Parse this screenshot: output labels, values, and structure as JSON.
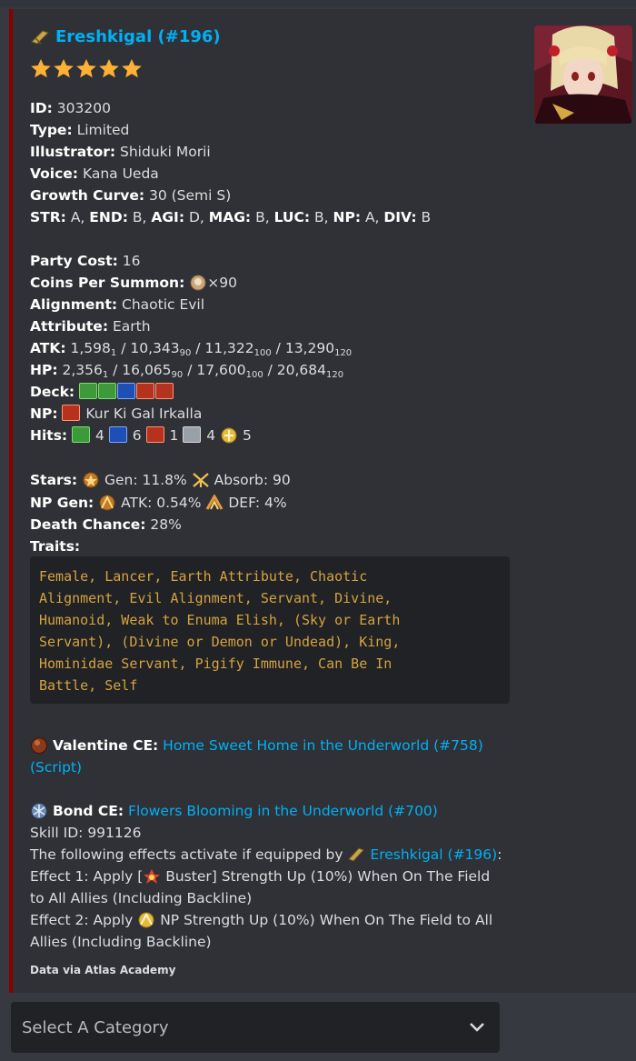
{
  "servant": {
    "name": "Ereshkigal (#196)",
    "rarity": 5,
    "id_label": "ID:",
    "id": "303200",
    "type_label": "Type:",
    "type": "Limited",
    "illustrator_label": "Illustrator:",
    "illustrator": "Shiduki Morii",
    "voice_label": "Voice:",
    "voice": "Kana Ueda",
    "growth_label": "Growth Curve:",
    "growth": "30 (Semi S)",
    "stats": [
      {
        "k": "STR:",
        "v": "A,"
      },
      {
        "k": "END:",
        "v": "B,"
      },
      {
        "k": "AGI:",
        "v": "D,"
      },
      {
        "k": "MAG:",
        "v": "B,"
      },
      {
        "k": "LUC:",
        "v": "B,"
      },
      {
        "k": "NP:",
        "v": "A,"
      },
      {
        "k": "DIV:",
        "v": "B"
      }
    ],
    "party_cost_label": "Party Cost:",
    "party_cost": "16",
    "coins_label": "Coins Per Summon:",
    "coins": "×90",
    "alignment_label": "Alignment:",
    "alignment": "Chaotic Evil",
    "attribute_label": "Attribute:",
    "attribute": "Earth",
    "atk_label": "ATK:",
    "atk": [
      [
        "1,598",
        "1"
      ],
      [
        "10,343",
        "90"
      ],
      [
        "11,322",
        "100"
      ],
      [
        "13,290",
        "120"
      ]
    ],
    "hp_label": "HP:",
    "hp": [
      [
        "2,356",
        "1"
      ],
      [
        "16,065",
        "90"
      ],
      [
        "17,600",
        "100"
      ],
      [
        "20,684",
        "120"
      ]
    ],
    "deck_label": "Deck:",
    "deck": [
      "quick",
      "quick",
      "arts",
      "buster",
      "buster"
    ],
    "np_label": "NP:",
    "np_name": "Kur Ki Gal Irkalla",
    "hits_label": "Hits:",
    "hits": [
      {
        "card": "quick",
        "n": "4"
      },
      {
        "card": "arts",
        "n": "6"
      },
      {
        "card": "buster",
        "n": "1"
      },
      {
        "card": "extra",
        "n": "4"
      },
      {
        "card": "np",
        "n": "5"
      }
    ],
    "stars_label": "Stars:",
    "star_gen": "Gen: 11.8%",
    "star_absorb": "Absorb: 90",
    "npgen_label": "NP Gen:",
    "npgen_atk": "ATK: 0.54%",
    "npgen_def": "DEF: 4%",
    "death_label": "Death Chance:",
    "death": "28%",
    "traits_label": "Traits:",
    "traits": "Female, Lancer, Earth Attribute, Chaotic\nAlignment, Evil Alignment, Servant, Divine,\nHumanoid, Weak to Enuma Elish, (Sky or Earth\nServant), (Divine or Demon or Undead), King,\nHominidae Servant, Pigify Immune, Can Be In\nBattle, Self"
  },
  "valentine": {
    "label": "Valentine CE:",
    "name": "Home Sweet Home in the Underworld (#758)",
    "script": "(Script)"
  },
  "bond": {
    "label": "Bond CE:",
    "name": "Flowers Blooming in the Underworld (#700)",
    "skill": "Skill ID: 991126",
    "equip_text": "The following effects activate if equipped by",
    "equip_link": "Ereshkigal (#196)",
    "e1a": "Effect 1: Apply [",
    "e1b": "Buster] Strength Up (10%) When On The Field",
    "e1c": "to All Allies (Including Backline)",
    "e2a": "Effect 2: Apply",
    "e2b": "NP Strength Up (10%) When On The Field to All",
    "e2c": "Allies (Including Backline)"
  },
  "footer": "Data via Atlas Academy",
  "select": {
    "placeholder": "Select A Category"
  },
  "colors": {
    "accent": "#00b0f4",
    "border": "#8b0000",
    "code": "#d6a23f"
  }
}
